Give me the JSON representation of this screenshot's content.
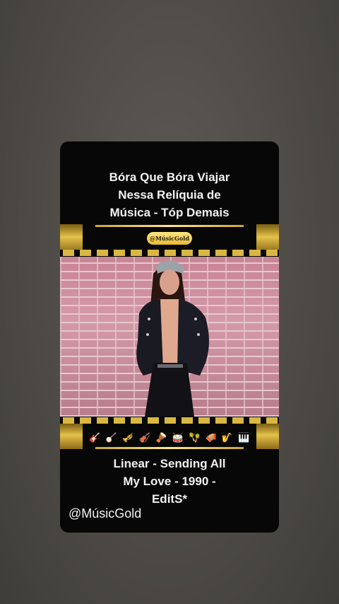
{
  "top_caption": {
    "line1": "Bóra Que Bóra Viajar",
    "line2": "Nessa Relíquia de",
    "line3": "Música - Tóp Demais"
  },
  "badge_text": "@MúsicGold",
  "video": {
    "icon": "play-video-frame"
  },
  "instruments": [
    {
      "icon": "electric-guitar-icon",
      "glyph": "🎸"
    },
    {
      "icon": "banjo-icon",
      "glyph": "🪕"
    },
    {
      "icon": "trumpet-icon",
      "glyph": "🎺"
    },
    {
      "icon": "violin-icon",
      "glyph": "🎻"
    },
    {
      "icon": "long-drum-icon",
      "glyph": "🪘"
    },
    {
      "icon": "drum-icon",
      "glyph": "🥁"
    },
    {
      "icon": "maracas-icon",
      "glyph": "🪇"
    },
    {
      "icon": "accordion-icon",
      "glyph": "🪗"
    },
    {
      "icon": "saxophone-icon",
      "glyph": "🎷"
    },
    {
      "icon": "piano-icon",
      "glyph": "🎹"
    }
  ],
  "bottom_caption": {
    "line1": "Linear - Sending All",
    "line2": "My Love - 1990 -",
    "line3": "EditS*"
  },
  "handle": "@MúsicGold",
  "colors": {
    "gold": "#e4c24a",
    "card": "#070707",
    "background": "#4e4b47"
  }
}
